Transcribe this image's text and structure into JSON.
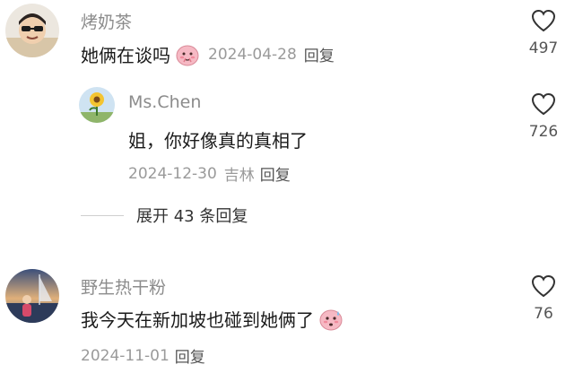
{
  "comments": [
    {
      "username": "烤奶茶",
      "text": "她俩在谈吗",
      "emoji": "shy-face-emoji",
      "date": "2024-04-28",
      "reply_label": "回复",
      "likes": "497"
    },
    {
      "username": "Ms.Chen",
      "text": "姐，你好像真的真相了",
      "date": "2024-12-30",
      "location": "吉林",
      "reply_label": "回复",
      "likes": "726"
    },
    {
      "username": "野生热干粉",
      "text": "我今天在新加坡也碰到她俩了",
      "emoji": "sweat-face-emoji",
      "date": "2024-11-01",
      "reply_label": "回复",
      "likes": "76"
    }
  ],
  "expand_replies": {
    "label": "展开 43 条回复"
  },
  "colors": {
    "username": "#8c8c8c",
    "text": "#1a1a1a",
    "meta": "#9a9a9a",
    "emoji_pink": "#f6b9c4"
  }
}
